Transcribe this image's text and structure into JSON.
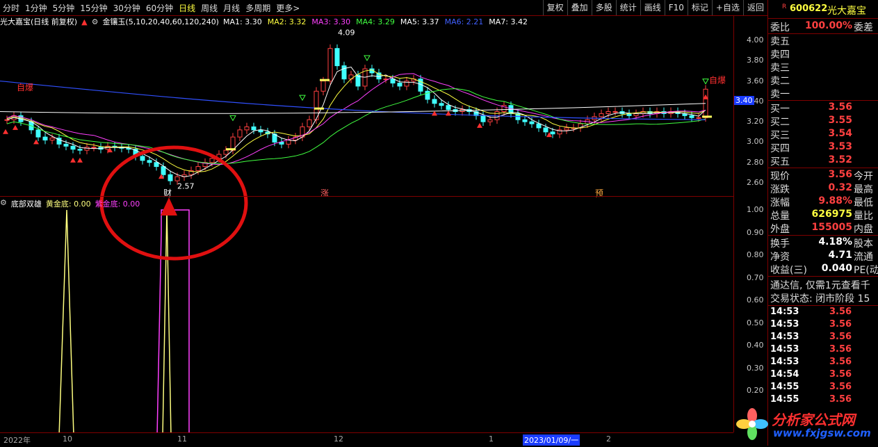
{
  "toolbar": {
    "periods": [
      "分时",
      "1分钟",
      "5分钟",
      "15分钟",
      "30分钟",
      "60分钟",
      "日线",
      "周线",
      "月线",
      "多周期",
      "更多>"
    ],
    "buttons": [
      "复权",
      "叠加",
      "多股",
      "统计",
      "画线",
      "F10",
      "标记",
      "+自选",
      "返回"
    ]
  },
  "info": {
    "title": "光大嘉宝(日线 前复权)",
    "indicator": "金镶玉(5,10,20,40,60,120,240)",
    "ma": [
      {
        "label": "MA1: 3.30",
        "color": "#ffffff"
      },
      {
        "label": "MA2: 3.32",
        "color": "#ffff40"
      },
      {
        "label": "MA3: 3.30",
        "color": "#ff40ff"
      },
      {
        "label": "MA4: 3.29",
        "color": "#40ff40"
      },
      {
        "label": "MA5: 3.37",
        "color": "#ffffff"
      },
      {
        "label": "MA6: 2.21",
        "color": "#4060ff"
      },
      {
        "label": "MA7: 3.42",
        "color": "#ffffff"
      }
    ]
  },
  "lower": {
    "name": "底部双雄",
    "gold": "黄金底: 0.00",
    "purple": "紫金底: 0.00"
  },
  "price_axis": [
    "4.00",
    "3.80",
    "3.60",
    "3.40",
    "3.20",
    "3.00",
    "2.80",
    "2.60"
  ],
  "lower_axis": [
    "1.00",
    "0.90",
    "0.80",
    "0.70",
    "0.60",
    "0.50",
    "0.40",
    "0.30",
    "0.20"
  ],
  "annotations": {
    "high": "4.09",
    "low": "2.57",
    "current": "3.40",
    "tag_zi_bao": "自爆",
    "tag_cai": "财",
    "tag_zhang": "涨",
    "tag_yu": "预"
  },
  "bottom_axis": [
    "2022年",
    "10",
    "11",
    "12",
    "1",
    "2023/01/09/一",
    "2"
  ],
  "quote": {
    "code": "600622",
    "name": "光大嘉宝",
    "weibi_label": "委比",
    "weibi_value": "100.00%",
    "weicha_label": "委差",
    "sell": [
      "卖五",
      "卖四",
      "卖三",
      "卖二",
      "卖一"
    ],
    "buy": [
      {
        "label": "买一",
        "price": "3.56"
      },
      {
        "label": "买二",
        "price": "3.55"
      },
      {
        "label": "买三",
        "price": "3.54"
      },
      {
        "label": "买四",
        "price": "3.53"
      },
      {
        "label": "买五",
        "price": "3.52"
      }
    ],
    "stats": [
      {
        "label": "现价",
        "value": "3.56",
        "label2": "今开",
        "color": "#ff4040"
      },
      {
        "label": "涨跌",
        "value": "0.32",
        "label2": "最高",
        "color": "#ff4040"
      },
      {
        "label": "涨幅",
        "value": "9.88%",
        "label2": "最低",
        "color": "#ff4040"
      },
      {
        "label": "总量",
        "value": "626975",
        "label2": "量比",
        "color": "#ffff40"
      },
      {
        "label": "外盘",
        "value": "155005",
        "label2": "内盘",
        "color": "#ff4040"
      }
    ],
    "stats2": [
      {
        "label": "换手",
        "value": "4.18%",
        "label2": "股本",
        "color": "#ffffff"
      },
      {
        "label": "净资",
        "value": "4.71",
        "label2": "流通",
        "color": "#ffffff"
      },
      {
        "label": "收益(三)",
        "value": "0.040",
        "label2": "PE(动",
        "color": "#ffffff"
      }
    ],
    "notice": "通达信, 仅需1元查看千",
    "status": "交易状态: 闭市阶段 15",
    "ticks": [
      {
        "time": "14:53",
        "price": "3.56"
      },
      {
        "time": "14:53",
        "price": "3.56"
      },
      {
        "time": "14:53",
        "price": "3.56"
      },
      {
        "time": "14:53",
        "price": "3.56"
      },
      {
        "time": "14:53",
        "price": "3.56"
      },
      {
        "time": "14:54",
        "price": "3.56"
      },
      {
        "time": "14:55",
        "price": "3.56"
      },
      {
        "time": "14:55",
        "price": "3.56"
      }
    ]
  },
  "watermark": {
    "cn": "分析家公式网",
    "url": "www.fxjgsw.com"
  }
}
